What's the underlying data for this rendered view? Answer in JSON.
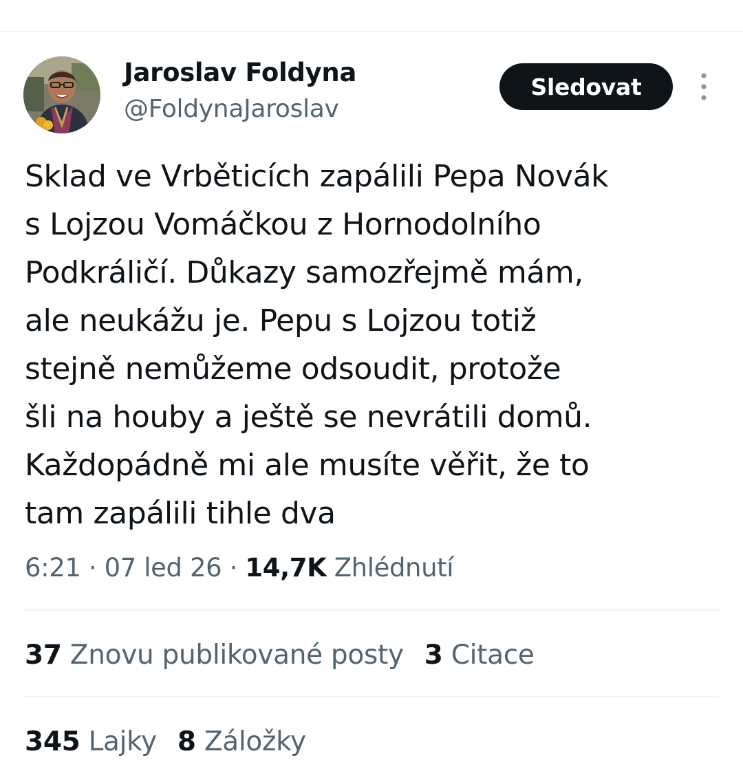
{
  "author": {
    "name": "Jaroslav Foldyna",
    "handle": "@FoldynaJaroslav"
  },
  "actions": {
    "follow_label": "Sledovat",
    "more_icon": "more-vertical-icon"
  },
  "tweet": {
    "lines": [
      "Sklad ve Vrběticích zapálili Pepa Novák",
      "s Lojzou Vomáčkou z Hornodolního",
      "Podkráličí. Důkazy samozřejmě mám,",
      "ale neukážu je. Pepu s Lojzou totiž",
      "stejně nemůžeme odsoudit, protože",
      "šli na houby a ještě se nevrátili domů.",
      "Každopádně mi ale musíte věřit, že to",
      "tam zapálili tihle dva"
    ]
  },
  "meta": {
    "time": "6:21",
    "separator": "·",
    "date": "07 led 26",
    "views_count": "14,7K",
    "views_label": "Zhlédnutí"
  },
  "stats": {
    "reposts_count": "37",
    "reposts_label": "Znovu publikované posty",
    "quotes_count": "3",
    "quotes_label": "Citace",
    "likes_count": "345",
    "likes_label": "Lajky",
    "bookmarks_count": "8",
    "bookmarks_label": "Záložky"
  },
  "colors": {
    "text_primary": "#0f1419",
    "text_secondary": "#536471",
    "divider": "#eff3f4",
    "button_bg": "#0f1419"
  }
}
